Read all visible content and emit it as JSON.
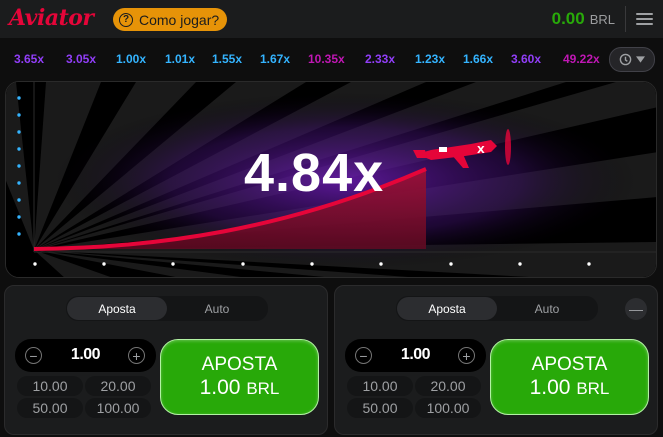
{
  "header": {
    "logo": "Aviator",
    "howto_label": "Como jogar?",
    "balance": "0.00",
    "currency": "BRL"
  },
  "history": [
    {
      "value": "3.65x",
      "color": "#913ef8"
    },
    {
      "value": "3.05x",
      "color": "#913ef8"
    },
    {
      "value": "1.00x",
      "color": "#34b4ff"
    },
    {
      "value": "1.01x",
      "color": "#34b4ff"
    },
    {
      "value": "1.55x",
      "color": "#34b4ff"
    },
    {
      "value": "1.67x",
      "color": "#34b4ff"
    },
    {
      "value": "10.35x",
      "color": "#c017b4"
    },
    {
      "value": "2.33x",
      "color": "#913ef8"
    },
    {
      "value": "1.23x",
      "color": "#34b4ff"
    },
    {
      "value": "1.66x",
      "color": "#34b4ff"
    },
    {
      "value": "3.60x",
      "color": "#913ef8"
    },
    {
      "value": "49.22x",
      "color": "#c017b4"
    }
  ],
  "game": {
    "multiplier": "4.84x",
    "curve_color": "#e50539"
  },
  "panels": [
    {
      "tab_bet": "Aposta",
      "tab_auto": "Auto",
      "amount": "1.00",
      "quick": [
        "10.00",
        "20.00",
        "50.00",
        "100.00"
      ],
      "button_line1": "APOSTA",
      "button_amount": "1.00",
      "button_currency": "BRL"
    },
    {
      "tab_bet": "Aposta",
      "tab_auto": "Auto",
      "amount": "1.00",
      "quick": [
        "10.00",
        "20.00",
        "50.00",
        "100.00"
      ],
      "button_line1": "APOSTA",
      "button_amount": "1.00",
      "button_currency": "BRL"
    }
  ]
}
